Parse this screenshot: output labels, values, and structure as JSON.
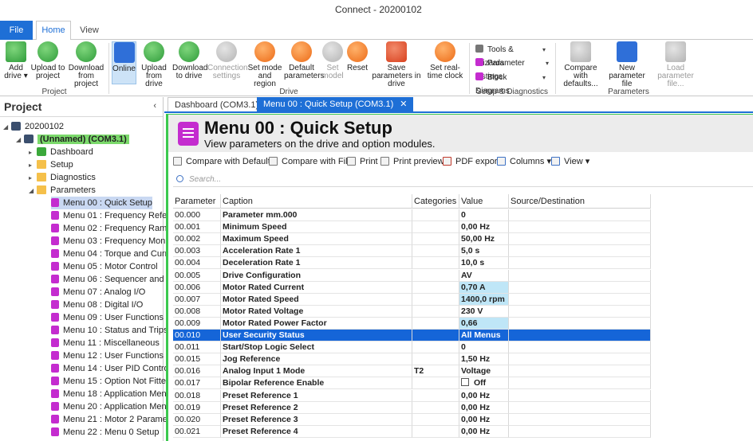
{
  "window": {
    "title": "Connect - 20200102"
  },
  "ribbon_tabs": {
    "file": "File",
    "home": "Home",
    "view": "View"
  },
  "ribbon": {
    "buttons": {
      "add_drive": "Add drive ▾",
      "upload_project": "Upload to project",
      "download_project": "Download from project",
      "online": "Online",
      "upload_drive": "Upload from drive",
      "download_drive": "Download to drive",
      "connection_settings": "Connection settings",
      "set_mode": "Set mode and region",
      "default_params": "Default parameters",
      "set_model": "Set model",
      "reset": "Reset",
      "save_params": "Save parameters in drive",
      "set_clock": "Set real-time clock",
      "compare_defaults": "Compare with defaults...",
      "new_param_file": "New parameter file",
      "load_param_file": "Load parameter file..."
    },
    "setup_items": {
      "tools": "Tools & Wizards",
      "listings": "Parameter Listings",
      "diagrams": "Block Diagrams"
    },
    "groups": {
      "project": "Project",
      "drive": "Drive",
      "setup": "Setup & Diagnostics",
      "parameters": "Parameters"
    }
  },
  "project": {
    "title": "Project",
    "root": "20200102",
    "drive": "(Unnamed) (COM3.1)",
    "nodes": {
      "dashboard": "Dashboard",
      "setup": "Setup",
      "diagnostics": "Diagnostics",
      "parameters": "Parameters"
    },
    "menus": [
      "Menu 00 : Quick Setup",
      "Menu 01 : Frequency Refere",
      "Menu 02 : Frequency Ramp",
      "Menu 03 : Frequency Monit",
      "Menu 04 : Torque and Curre",
      "Menu 05 : Motor Control",
      "Menu 06 : Sequencer and C",
      "Menu 07 : Analog I/O",
      "Menu 08 : Digital I/O",
      "Menu 09 : User Functions 1",
      "Menu 10 : Status and Trips",
      "Menu 11 : Miscellaneous",
      "Menu 12 : User Functions 2",
      "Menu 14 : User PID Control",
      "Menu 15 : Option Not Fitte",
      "Menu 18 : Application Menu",
      "Menu 20 : Application Menu",
      "Menu 21 : Motor 2 Paramet",
      "Menu 22 : Menu 0 Setup"
    ]
  },
  "doc_tabs": {
    "dashboard": "Dashboard (COM3.1)",
    "menu00": "Menu 00 : Quick Setup (COM3.1)",
    "close": "✕"
  },
  "menu": {
    "title": "Menu 00 : Quick Setup",
    "subtitle": "View parameters on the drive and option modules."
  },
  "toolbar": {
    "compare_defaults": "Compare with Defaults",
    "compare_file": "Compare with File",
    "print": "Print",
    "print_preview": "Print preview",
    "pdf_export": "PDF export",
    "columns": "Columns ▾",
    "view": "View ▾"
  },
  "search": {
    "placeholder": "Search..."
  },
  "table": {
    "headers": [
      "Parameter",
      "Caption",
      "Categories",
      "Value",
      "Source/Destination"
    ],
    "rows": [
      [
        "00.000",
        "Parameter mm.000",
        "",
        "0",
        ""
      ],
      [
        "00.001",
        "Minimum Speed",
        "",
        "0,00 Hz",
        ""
      ],
      [
        "00.002",
        "Maximum Speed",
        "",
        "50,00 Hz",
        ""
      ],
      [
        "00.003",
        "Acceleration Rate 1",
        "",
        "5,0 s",
        ""
      ],
      [
        "00.004",
        "Deceleration Rate 1",
        "",
        "10,0 s",
        ""
      ],
      [
        "00.005",
        "Drive Configuration",
        "",
        "AV",
        ""
      ],
      [
        "00.006",
        "Motor Rated Current",
        "",
        "0,70 A",
        ""
      ],
      [
        "00.007",
        "Motor Rated Speed",
        "",
        "1400,0 rpm",
        ""
      ],
      [
        "00.008",
        "Motor Rated Voltage",
        "",
        "230 V",
        ""
      ],
      [
        "00.009",
        "Motor Rated Power Factor",
        "",
        "0,66",
        ""
      ],
      [
        "00.010",
        "User Security Status",
        "",
        "All Menus",
        ""
      ],
      [
        "00.011",
        "Start/Stop Logic Select",
        "",
        "0",
        ""
      ],
      [
        "00.015",
        "Jog Reference",
        "",
        "1,50 Hz",
        ""
      ],
      [
        "00.016",
        "Analog Input 1 Mode",
        "T2",
        "Voltage",
        ""
      ],
      [
        "00.017",
        "Bipolar Reference Enable",
        "",
        "Off",
        ""
      ],
      [
        "00.018",
        "Preset Reference 1",
        "",
        "0,00 Hz",
        ""
      ],
      [
        "00.019",
        "Preset Reference 2",
        "",
        "0,00 Hz",
        ""
      ],
      [
        "00.020",
        "Preset Reference 3",
        "",
        "0,00 Hz",
        ""
      ],
      [
        "00.021",
        "Preset Reference 4",
        "",
        "0,00 Hz",
        ""
      ]
    ],
    "selected_row": "00.010",
    "modified_rows": [
      "00.006",
      "00.007",
      "00.009"
    ]
  },
  "colors": {
    "accent": "#1e6fd6",
    "selection": "#1565d8",
    "online_green": "#3bc94e",
    "modified": "#bfe6f7",
    "menu_icon": "#c42ccf"
  }
}
